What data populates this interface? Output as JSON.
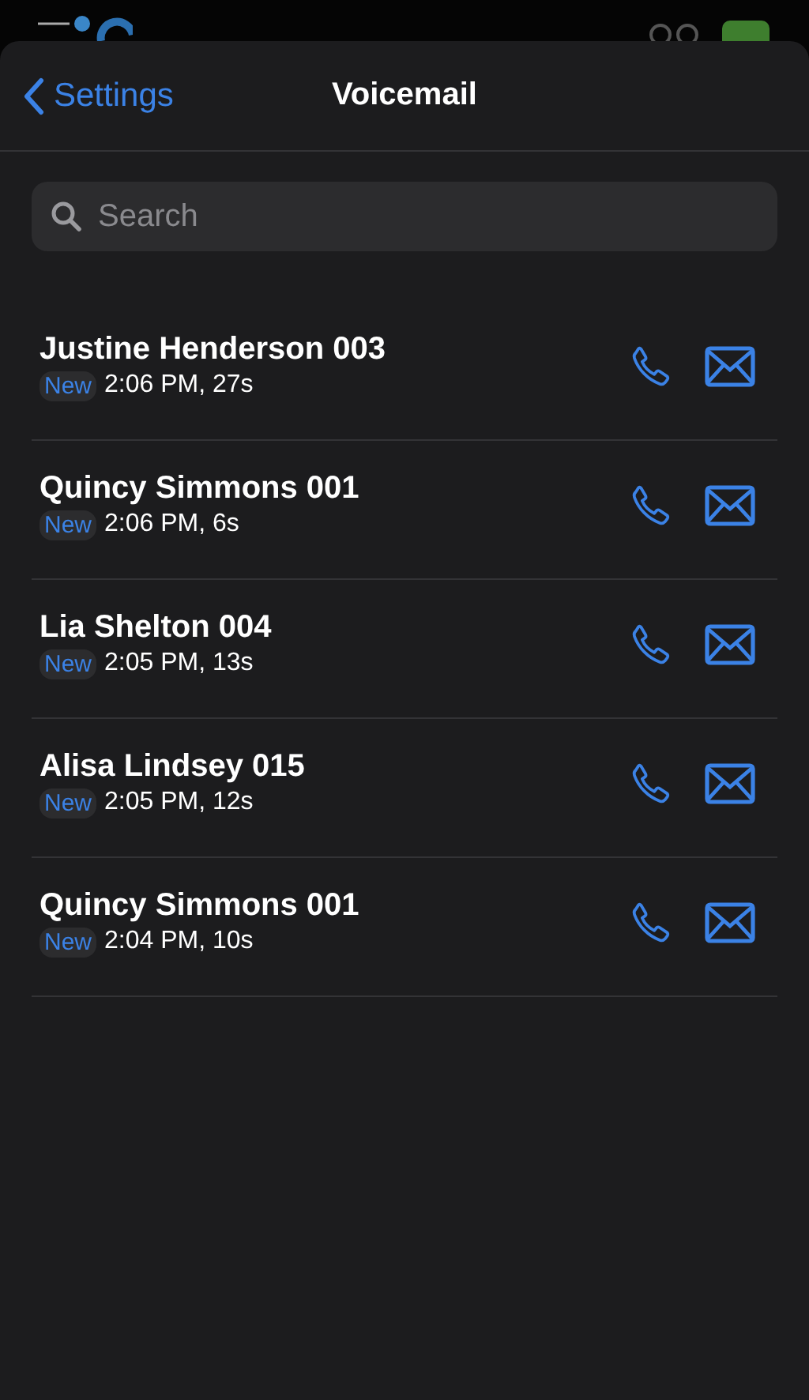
{
  "nav": {
    "back": "Settings",
    "title": "Voicemail"
  },
  "search": {
    "placeholder": "Search"
  },
  "voicemails": [
    {
      "name": "Justine Henderson 003",
      "badge": "New",
      "time": "2:06 PM, 27s"
    },
    {
      "name": "Quincy Simmons 001",
      "badge": "New",
      "time": "2:06 PM, 6s"
    },
    {
      "name": "Lia Shelton 004",
      "badge": "New",
      "time": "2:05 PM, 13s"
    },
    {
      "name": "Alisa Lindsey 015",
      "badge": "New",
      "time": "2:05 PM, 12s"
    },
    {
      "name": "Quincy Simmons 001",
      "badge": "New",
      "time": "2:04 PM, 10s"
    }
  ]
}
